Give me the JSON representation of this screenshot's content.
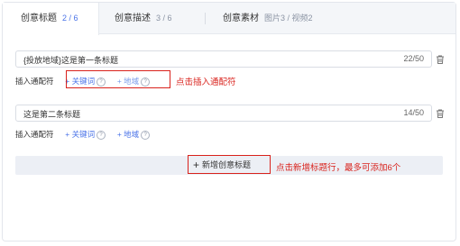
{
  "tabs": [
    {
      "label": "创意标题",
      "count": "2 / 6"
    },
    {
      "label": "创意描述",
      "count": "3 / 6"
    },
    {
      "label": "创意素材",
      "count": "图片3 / 视频2"
    }
  ],
  "titles": [
    {
      "value": "{投放地域}这是第一条标题",
      "count": "22/50"
    },
    {
      "value": "这是第二条标题",
      "count": "14/50"
    }
  ],
  "wildcard": {
    "label": "插入通配符",
    "keyword": "+ 关键词",
    "region": "+ 地域"
  },
  "annotations": {
    "insert_hint": "点击插入通配符",
    "add_hint": "点击新增标题行，最多可添加6个"
  },
  "add_button": {
    "label": "新增创意标题",
    "icon": "plus-icon"
  },
  "colors": {
    "accent": "#4a73e8",
    "annotation": "#d9221c"
  }
}
